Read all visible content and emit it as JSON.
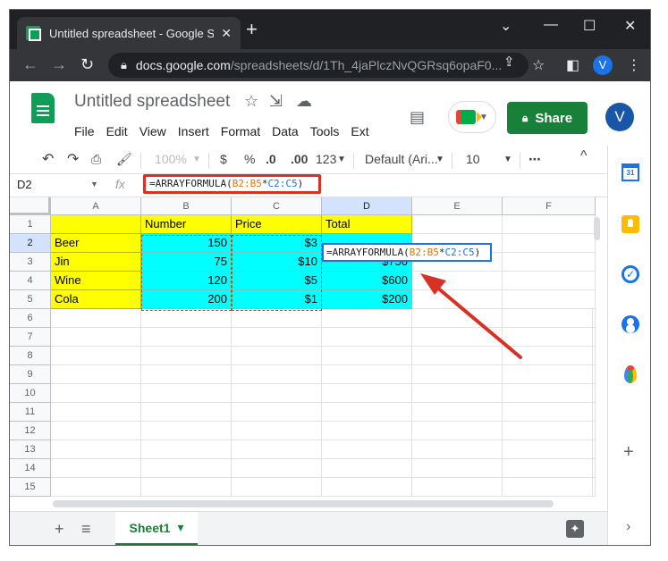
{
  "browser": {
    "tab_title": "Untitled spreadsheet - Google Sh",
    "tab_close": "✕",
    "new_tab": "+",
    "window_controls": [
      "⌄",
      "—",
      "☐",
      "✕"
    ],
    "url_host": "docs.google.com",
    "url_path": "/spreadsheets/d/1Th_4jaPlczNvQGRsq6opaF0...",
    "profile_initial": "V"
  },
  "docs": {
    "title": "Untitled spreadsheet",
    "menu": [
      "File",
      "Edit",
      "View",
      "Insert",
      "Format",
      "Data",
      "Tools",
      "Ext"
    ],
    "share_label": "Share",
    "profile_initial": "V"
  },
  "toolbar": {
    "zoom": "100%",
    "currency": "$",
    "percent": "%",
    "decrease_decimal": ".0",
    "increase_decimal": ".00",
    "more_formats": "123",
    "font": "Default (Ari...",
    "font_size": "10",
    "more": "⋯",
    "collapse": "^"
  },
  "formula_bar": {
    "name_box": "D2",
    "fx": "fx",
    "formula_prefix": "=ARRAYFORMULA(",
    "ref1": "B2:B5",
    "op": "*",
    "ref2": "C2:C5",
    "formula_suffix": ")"
  },
  "grid": {
    "columns": [
      "A",
      "B",
      "C",
      "D",
      "E",
      "F"
    ],
    "rows": [
      "1",
      "2",
      "3",
      "4",
      "5",
      "6",
      "7",
      "8",
      "9",
      "10",
      "11",
      "12",
      "13",
      "14",
      "15"
    ],
    "header_row": [
      "",
      "Number",
      "Price",
      "Total"
    ],
    "data": [
      {
        "item": "Beer",
        "number": "150",
        "price": "$3",
        "total": ""
      },
      {
        "item": "Jin",
        "number": "75",
        "price": "$10",
        "total": "$750"
      },
      {
        "item": "Wine",
        "number": "120",
        "price": "$5",
        "total": "$600"
      },
      {
        "item": "Cola",
        "number": "200",
        "price": "$1",
        "total": "$200"
      }
    ],
    "editing_cell_formula": {
      "prefix": "=ARRAYFORMULA(",
      "ref1": "B2:B5",
      "op": "*",
      "ref2": "C2:C5",
      "suffix": ")"
    }
  },
  "sheet_bar": {
    "add": "+",
    "all_sheets": "≡",
    "sheet_name": "Sheet1",
    "sheet_caret": "▾",
    "explore": "✦"
  },
  "side_panel": {
    "calendar_day": "31",
    "add": "+",
    "expand": "›"
  },
  "colors": {
    "header_yellow": "#ffff00",
    "data_cyan": "#00ffff",
    "share_green": "#188038",
    "annotation_red": "#d93025",
    "ref_orange": "#e37400",
    "ref_blue": "#1a73e8"
  }
}
